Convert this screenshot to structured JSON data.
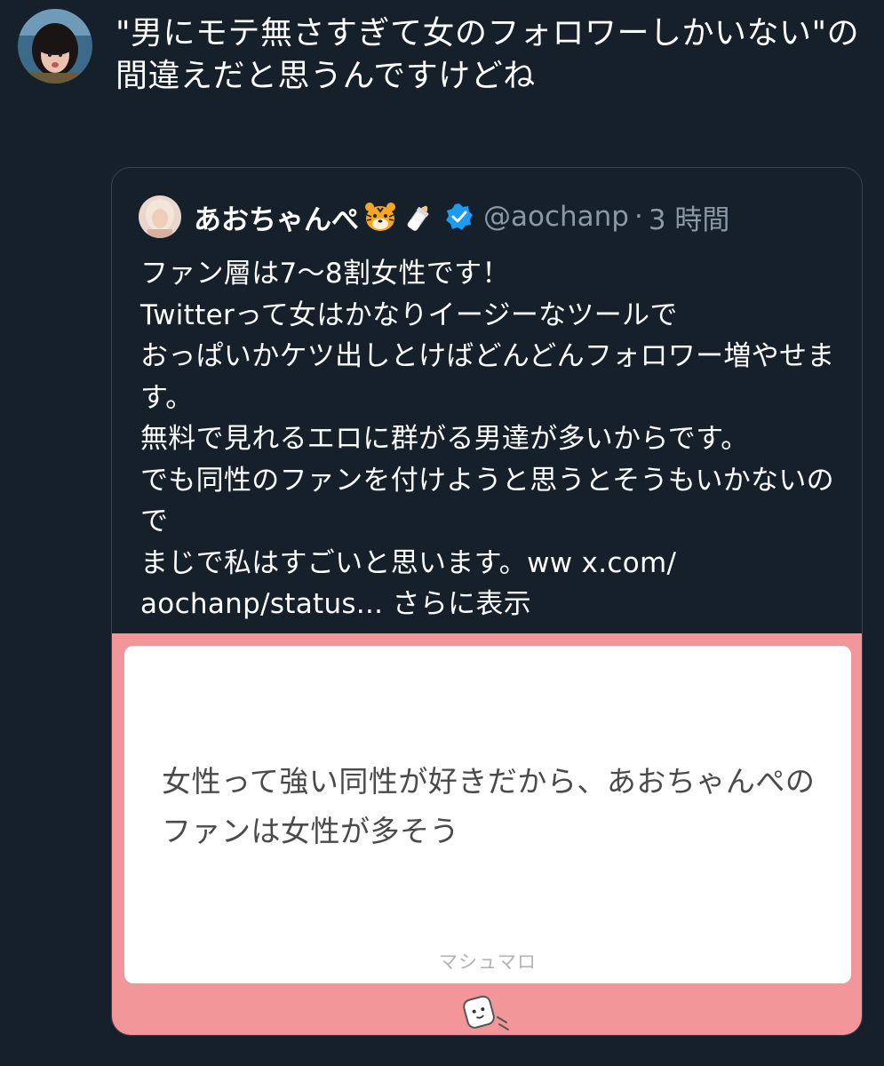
{
  "tweet": {
    "text": "\"男にモテ無さすぎて女のフォロワーしかいない\"の間違えだと思うんですけどね"
  },
  "quote": {
    "display_name": "あおちゃんぺ",
    "emoji_1": "tiger-face",
    "emoji_2": "baby-bottle",
    "verified_icon": "verified-badge-icon",
    "handle": "@aochanp",
    "separator": "·",
    "time": "3 時間",
    "body": "ファン層は7〜8割女性です！\nTwitterって女はかなりイージーなツールで\nおっぱいかケツ出しとけばどんどんフォロワー増やせます。\n無料で見れるエロに群がる男達が多いからです。\nでも同性のファンを付けようと思うとそうもいかないので\nまじで私はすごいと思います。ww x.com/\naochanp/status...",
    "show_more": "さらに表示"
  },
  "marshmallow": {
    "question": "女性って強い同性が好きだから、あおちゃんぺのファンは女性が多そう",
    "brand": "マシュマロ",
    "background_color": "#f29699"
  },
  "colors": {
    "background": "#15202b",
    "border": "#38444d",
    "secondary_text": "#8b98a5",
    "verified": "#1d9bf0"
  }
}
